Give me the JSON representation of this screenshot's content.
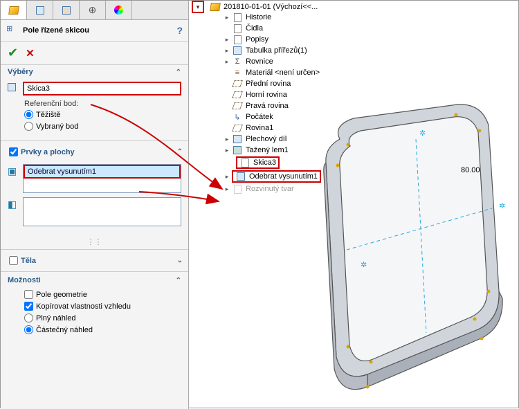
{
  "title": "Pole řízené skicou",
  "selections": {
    "header": "Výběry",
    "sketch": "Skica3",
    "ref_label": "Referenční bod:",
    "radio_centroid": "Těžiště",
    "radio_selpoint": "Vybraný bod"
  },
  "features": {
    "header": "Prvky a plochy",
    "item": "Odebrat vysunutím1"
  },
  "bodies": {
    "header": "Těla"
  },
  "options": {
    "header": "Možnosti",
    "geom": "Pole geometrie",
    "copy": "Kopírovat vlastnosti vzhledu",
    "full": "Plný náhled",
    "partial": "Částečný náhled"
  },
  "tree": {
    "root": "201810-01-01 (Výchozí<<...",
    "items": [
      "Historie",
      "Čidla",
      "Popisy",
      "Tabulka přířezů(1)",
      "Rovnice",
      "Materiál <není určen>",
      "Přední rovina",
      "Horní rovina",
      "Pravá rovina",
      "Počátek",
      "Rovina1",
      "Plechový díl",
      "Tažený lem1"
    ],
    "hl1": "Skica3",
    "hl2": "Odebrat vysunutím1",
    "last": "Rozvinutý tvar"
  }
}
